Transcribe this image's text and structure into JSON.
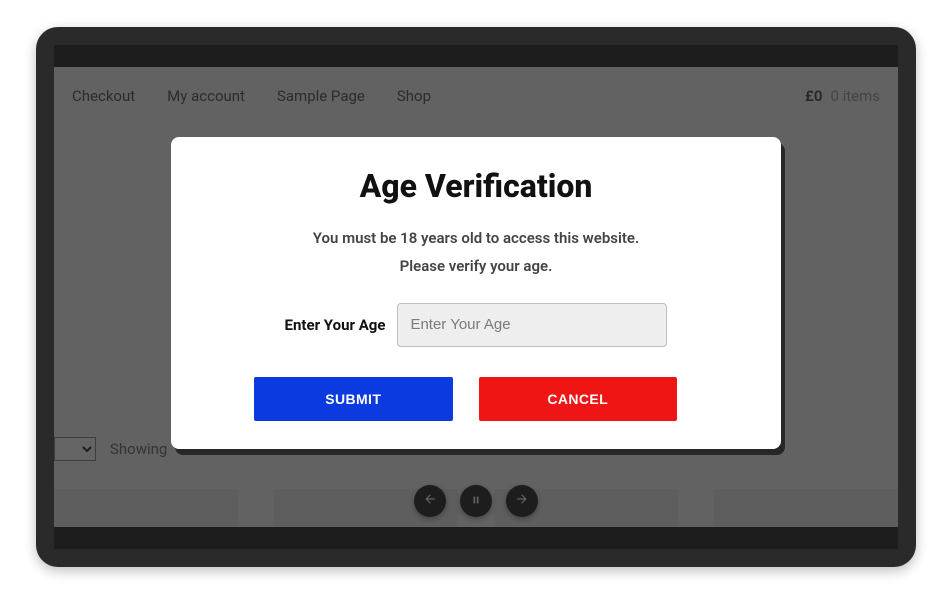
{
  "nav": {
    "items": [
      "Checkout",
      "My account",
      "Sample Page",
      "Shop"
    ],
    "cart_total": "£0",
    "cart_items": "0 items"
  },
  "sorting": {
    "showing_label": "Showing"
  },
  "slider": {
    "prev": "prev",
    "pause": "pause",
    "next": "next"
  },
  "modal": {
    "title": "Age Verification",
    "line1": "You must be 18 years old to access this website.",
    "line2": "Please verify your age.",
    "age_label": "Enter Your Age",
    "age_placeholder": "Enter Your Age",
    "submit_label": "SUBMIT",
    "cancel_label": "CANCEL"
  }
}
